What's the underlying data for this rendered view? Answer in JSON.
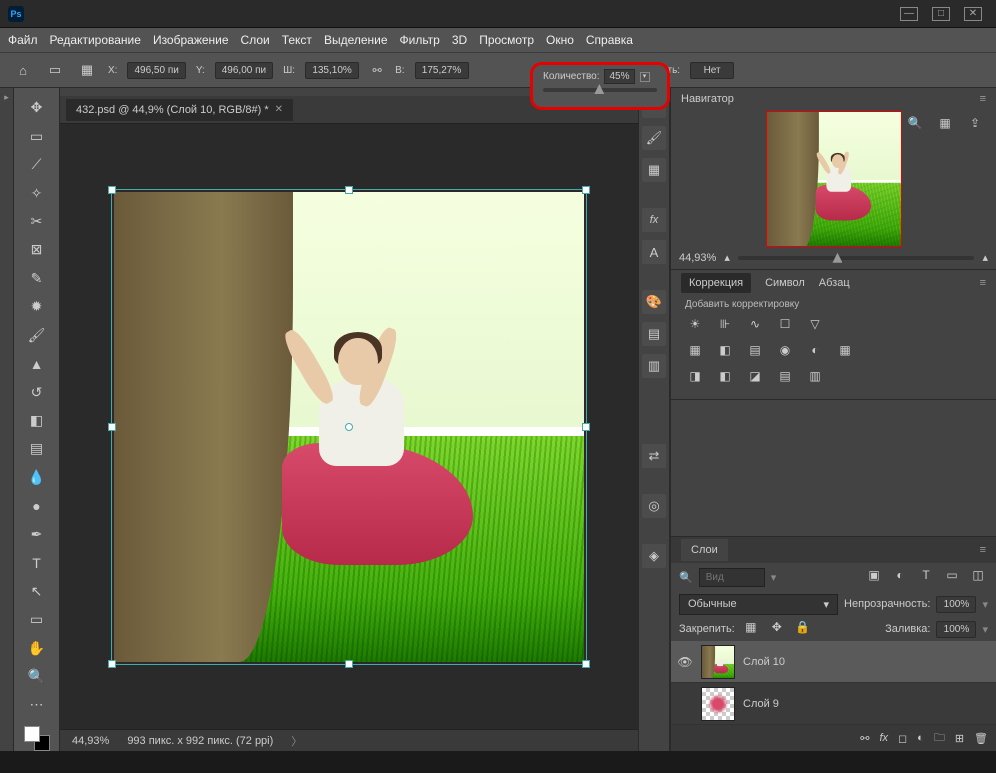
{
  "menu": {
    "file": "Файл",
    "edit": "Редактирование",
    "image": "Изображение",
    "layer": "Слои",
    "text": "Текст",
    "select": "Выделение",
    "filter": "Фильтр",
    "threed": "3D",
    "view": "Просмотр",
    "window": "Окно",
    "help": "Справка"
  },
  "options": {
    "x_lbl": "X:",
    "x_val": "496,50 пи",
    "y_lbl": "Y:",
    "y_val": "496,00 пи",
    "w_lbl": "Ш:",
    "w_val": "135,10%",
    "h_lbl": "В:",
    "h_val": "175,27%",
    "amount_lbl": "Количество:",
    "amount_val": "45%",
    "protect_lbl": "Защищать:",
    "protect_val": "Нет"
  },
  "tab": {
    "title": "432.psd @ 44,9% (Слой 10, RGB/8#) *"
  },
  "status": {
    "zoom": "44,93%",
    "dims": "993 пикс. x 992 пикс. (72 ppi)"
  },
  "nav": {
    "title": "Навигатор",
    "zoom": "44,93%"
  },
  "adj": {
    "tab1": "Коррекция",
    "tab2": "Символ",
    "tab3": "Абзац",
    "hint": "Добавить корректировку"
  },
  "layers": {
    "title": "Слои",
    "search_ph": "Вид",
    "mode": "Обычные",
    "opacity_lbl": "Непрозрачность:",
    "opacity_val": "100%",
    "lock_lbl": "Закрепить:",
    "fill_lbl": "Заливка:",
    "fill_val": "100%",
    "layer10": "Слой 10",
    "layer9": "Слой 9"
  }
}
